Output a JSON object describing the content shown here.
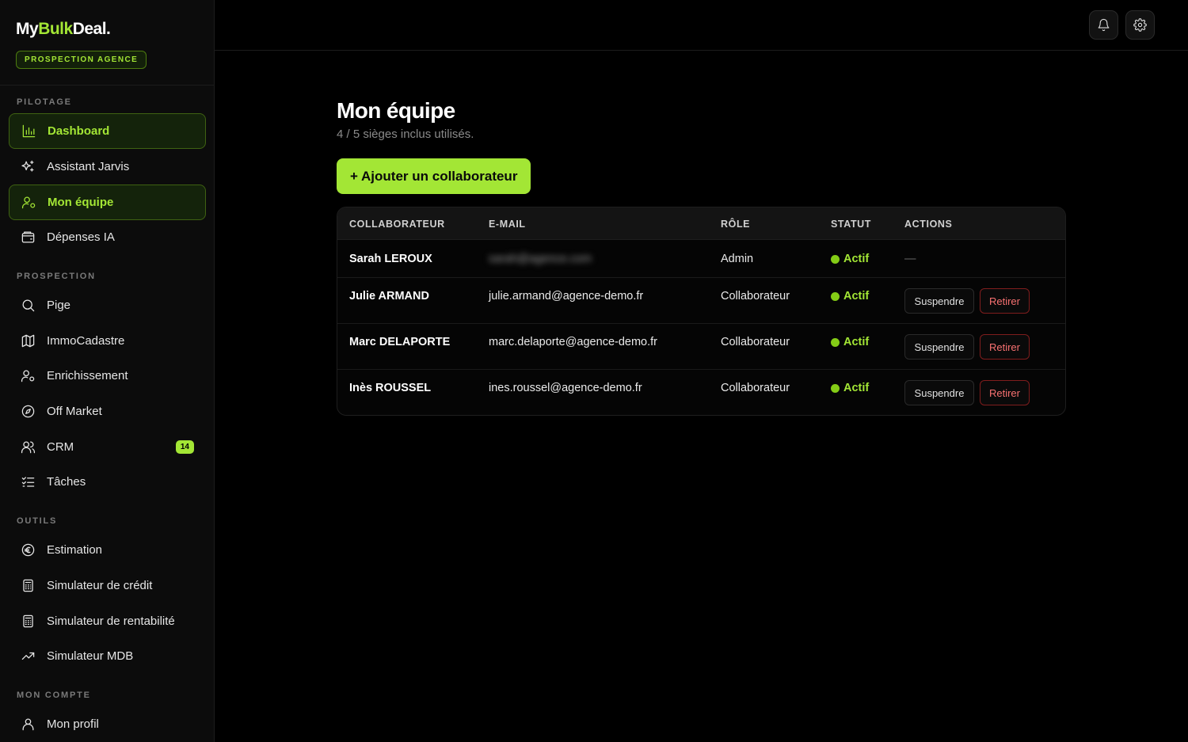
{
  "brand": {
    "logo_prefix": "My",
    "logo_accent": "Bulk",
    "logo_suffix": "Deal.",
    "agency_badge": "PROSPECTION AGENCE"
  },
  "sidebar": {
    "sections": {
      "pilotage": "PILOTAGE",
      "prospection": "PROSPECTION",
      "outils": "OUTILS",
      "compte": "MON COMPTE"
    },
    "items": {
      "dashboard": "Dashboard",
      "jarvis": "Assistant Jarvis",
      "equipe": "Mon équipe",
      "depenses": "Dépenses IA",
      "pige": "Pige",
      "cadastre": "ImmoCadastre",
      "enrichissement": "Enrichissement",
      "offmarket": "Off Market",
      "crm": "CRM",
      "crm_count": "14",
      "taches": "Tâches",
      "estimation": "Estimation",
      "credit": "Simulateur de crédit",
      "rentabilite": "Simulateur de rentabilité",
      "mdb": "Simulateur MDB",
      "profil": "Mon profil"
    }
  },
  "page": {
    "title": "Mon équipe",
    "subtitle": "4 / 5 sièges inclus utilisés.",
    "add_button": "+ Ajouter un collaborateur"
  },
  "table": {
    "headers": {
      "collab": "COLLABORATEUR",
      "email": "E-MAIL",
      "role": "RÔLE",
      "statut": "STATUT",
      "actions": "ACTIONS"
    },
    "rows": [
      {
        "name": "Sarah LEROUX",
        "email": "sarah@agence.com",
        "role": "Admin",
        "status": "Actif",
        "actions": "—"
      },
      {
        "name": "Julie ARMAND",
        "email": "julie.armand@agence-demo.fr",
        "role": "Collaborateur",
        "status": "Actif",
        "suspend": "Suspendre",
        "remove": "Retirer"
      },
      {
        "name": "Marc DELAPORTE",
        "email": "marc.delaporte@agence-demo.fr",
        "role": "Collaborateur",
        "status": "Actif",
        "suspend": "Suspendre",
        "remove": "Retirer"
      },
      {
        "name": "Inès ROUSSEL",
        "email": "ines.roussel@agence-demo.fr",
        "role": "Collaborateur",
        "status": "Actif",
        "suspend": "Suspendre",
        "remove": "Retirer"
      }
    ]
  },
  "colors": {
    "accent": "#a3e635",
    "danger": "#f87171",
    "background": "#000000"
  }
}
